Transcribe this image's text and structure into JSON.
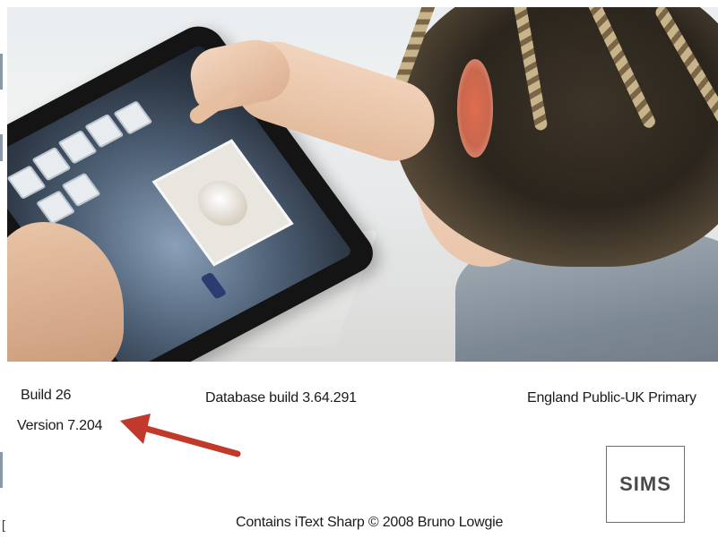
{
  "splash": {
    "build": "Build 26",
    "version": "Version 7.204",
    "database_build": "Database build 3.64.291",
    "region": "England Public-UK Primary",
    "copyright": "Contains iText Sharp © 2008 Bruno Lowgie",
    "logo_text": "SIMS",
    "edge_glyph": "["
  },
  "colors": {
    "arrow": "#c0392b",
    "logo_text": "#4a4a4a",
    "background": "#ffffff"
  },
  "icons": {
    "annotation_arrow": "arrow-icon"
  }
}
